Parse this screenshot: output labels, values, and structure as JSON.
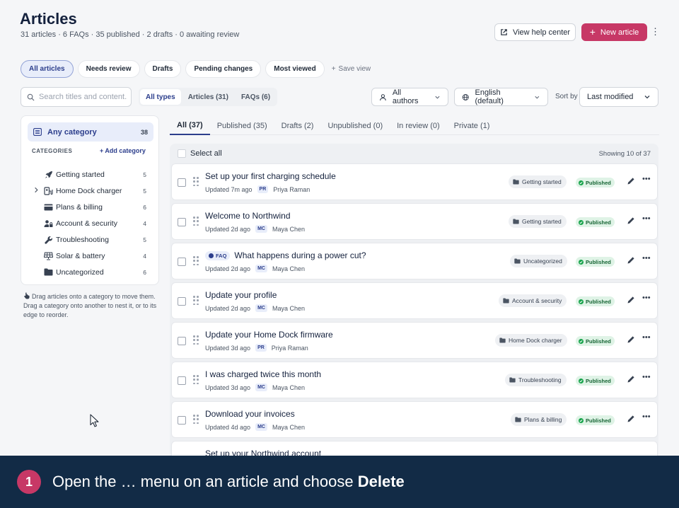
{
  "header": {
    "title": "Articles",
    "subtitle": "31 articles · 6 FAQs · 35 published · 2 drafts · 0 awaiting review",
    "help_label": "View help center",
    "new_label": "New article",
    "more_glyph": "⋮"
  },
  "views": {
    "items": [
      {
        "label": "All articles",
        "active": true
      },
      {
        "label": "Needs review"
      },
      {
        "label": "Drafts"
      },
      {
        "label": "Pending changes"
      },
      {
        "label": "Most viewed"
      }
    ],
    "save_label": "Save view",
    "save_glyph": "+"
  },
  "search": {
    "placeholder": "Search titles and content..."
  },
  "types": [
    {
      "label": "All types",
      "active": true
    },
    {
      "label": "Articles (31)"
    },
    {
      "label": "FAQs (6)"
    }
  ],
  "filters": {
    "authors": "All authors",
    "language": "English (default)",
    "sort_label": "Sort by",
    "sort_value": "Last modified"
  },
  "sidebar": {
    "any_label": "Any category",
    "any_count": "38",
    "heading": "CATEGORIES",
    "add_label": "+ Add category",
    "categories": [
      {
        "label": "Getting started",
        "count": "5",
        "icon": "rocket-icon"
      },
      {
        "label": "Home Dock charger",
        "count": "5",
        "icon": "charger-icon",
        "expandable": true
      },
      {
        "label": "Plans & billing",
        "count": "6",
        "icon": "credit-card-icon"
      },
      {
        "label": "Account & security",
        "count": "4",
        "icon": "user-lock-icon"
      },
      {
        "label": "Troubleshooting",
        "count": "5",
        "icon": "wrench-icon"
      },
      {
        "label": "Solar & battery",
        "count": "4",
        "icon": "solar-panel-icon"
      },
      {
        "label": "Uncategorized",
        "count": "6",
        "icon": "folder-icon"
      }
    ],
    "hint": "Drag articles onto a category to move them. Drag a category onto another to nest it, or to its edge to reorder."
  },
  "tabs": [
    {
      "label": "All (37)",
      "active": true
    },
    {
      "label": "Published (35)"
    },
    {
      "label": "Drafts (2)"
    },
    {
      "label": "Unpublished (0)"
    },
    {
      "label": "In review (0)"
    },
    {
      "label": "Private (1)"
    }
  ],
  "list": {
    "select_all": "Select all",
    "showing": "Showing 10 of 37",
    "rows": [
      {
        "title": "Set up your first charging schedule",
        "updated": "Updated 7m ago",
        "initials": "PR",
        "author": "Priya Raman",
        "category": "Getting started",
        "status": "Published"
      },
      {
        "title": "Welcome to Northwind",
        "updated": "Updated 2d ago",
        "initials": "MC",
        "author": "Maya Chen",
        "category": "Getting started",
        "status": "Published"
      },
      {
        "title": "What happens during a power cut?",
        "faq": "FAQ",
        "updated": "Updated 2d ago",
        "initials": "MC",
        "author": "Maya Chen",
        "category": "Uncategorized",
        "status": "Published"
      },
      {
        "title": "Update your profile",
        "updated": "Updated 2d ago",
        "initials": "MC",
        "author": "Maya Chen",
        "category": "Account & security",
        "status": "Published"
      },
      {
        "title": "Update your Home Dock firmware",
        "updated": "Updated 3d ago",
        "initials": "PR",
        "author": "Priya Raman",
        "category": "Home Dock charger",
        "status": "Published"
      },
      {
        "title": "I was charged twice this month",
        "updated": "Updated 3d ago",
        "initials": "MC",
        "author": "Maya Chen",
        "category": "Troubleshooting",
        "status": "Published"
      },
      {
        "title": "Download your invoices",
        "updated": "Updated 4d ago",
        "initials": "MC",
        "author": "Maya Chen",
        "category": "Plans & billing",
        "status": "Published"
      },
      {
        "title": "Set up your Northwind account",
        "updated": "",
        "initials": "",
        "author": "",
        "category": "",
        "status": ""
      }
    ]
  },
  "banner": {
    "step": "1",
    "text_before": "Open the … menu on an article and choose ",
    "text_bold": "Delete"
  },
  "colors": {
    "accent": "#2c3e8c",
    "primary_button": "#c73866",
    "banner_bg": "#122b46",
    "published": "#16a34a"
  }
}
